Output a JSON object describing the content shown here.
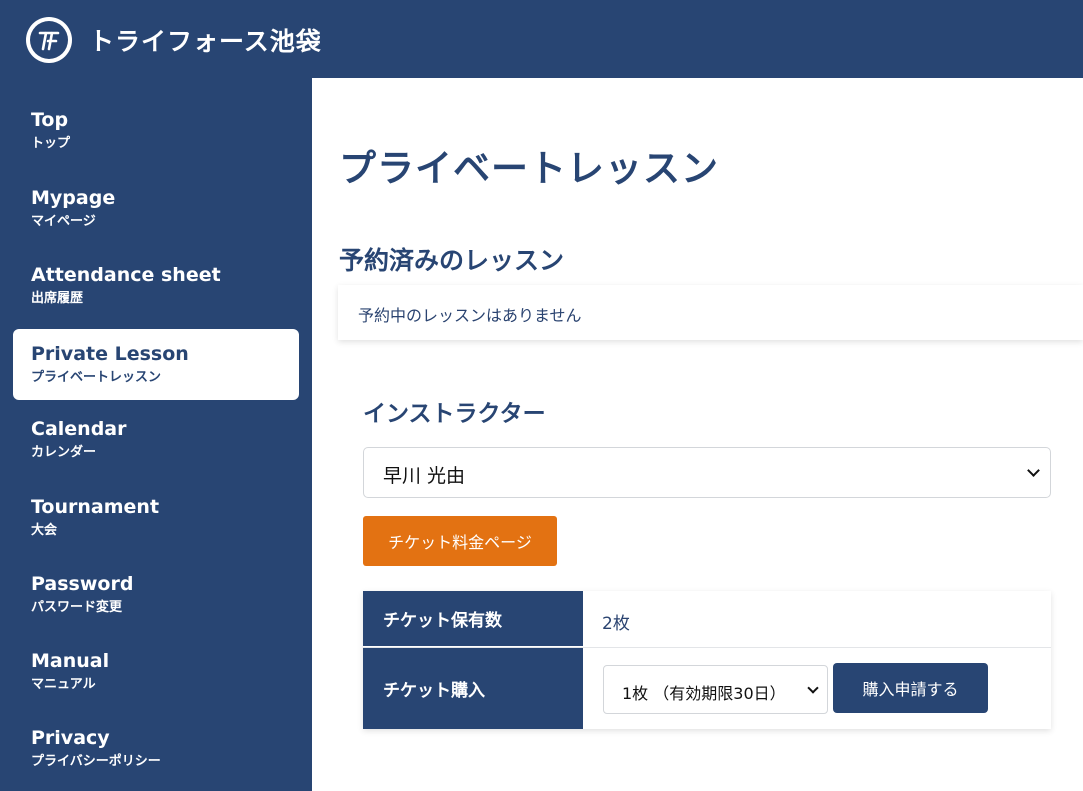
{
  "header": {
    "site_title": "トライフォース池袋",
    "logo_icon": "triforce-logo-icon",
    "bg_color": "#284573"
  },
  "sidebar": {
    "items": [
      {
        "en": "Top",
        "jp": "トップ",
        "active": false
      },
      {
        "en": "Mypage",
        "jp": "マイページ",
        "active": false
      },
      {
        "en": "Attendance sheet",
        "jp": "出席履歴",
        "active": false
      },
      {
        "en": "Private Lesson",
        "jp": "プライベートレッスン",
        "active": true
      },
      {
        "en": "Calendar",
        "jp": "カレンダー",
        "active": false
      },
      {
        "en": "Tournament",
        "jp": "大会",
        "active": false
      },
      {
        "en": "Password",
        "jp": "パスワード変更",
        "active": false
      },
      {
        "en": "Manual",
        "jp": "マニュアル",
        "active": false
      },
      {
        "en": "Privacy",
        "jp": "プライバシーポリシー",
        "active": false
      }
    ]
  },
  "main": {
    "page_title": "プライベートレッスン",
    "reserved_section_title": "予約済みのレッスン",
    "no_reservation_text": "予約中のレッスンはありません",
    "instructor_label": "インストラクター",
    "instructor_selected": "早川 光由",
    "ticket_price_button": "チケット料金ページ",
    "ticket_price_button_color": "#e37212",
    "ticket_table": {
      "held_label": "チケット保有数",
      "held_value": "2枚",
      "purchase_label": "チケット購入",
      "purchase_option_selected": "1枚 （有効期限30日）",
      "purchase_button": "購入申請する"
    }
  }
}
